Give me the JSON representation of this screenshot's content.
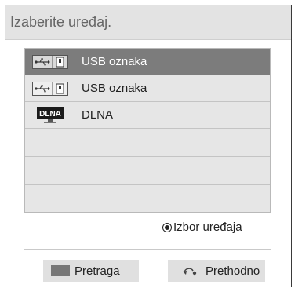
{
  "dialog": {
    "title": "Izaberite uređaj."
  },
  "devices": [
    {
      "label": "USB oznaka",
      "icon": "usb-drive-icon",
      "selected": true
    },
    {
      "label": "USB oznaka",
      "icon": "usb-drive-icon",
      "selected": false
    },
    {
      "label": "DLNA",
      "icon": "dlna-icon",
      "selected": false,
      "icon_text": "DLNA"
    }
  ],
  "hint": {
    "label": "Izbor uređaja",
    "icon": "radio-select-icon"
  },
  "buttons": {
    "search_label": "Pretraga",
    "search_color": "#777777",
    "back_label": "Prethodno",
    "back_icon": "back-arrow-icon"
  },
  "colors": {
    "selected_row": "#7c7c7c",
    "row_bg": "#e6e6e6",
    "title_bg": "#e3e3e3"
  }
}
